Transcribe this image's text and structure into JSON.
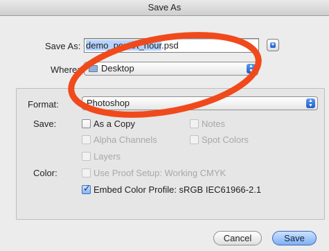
{
  "window": {
    "title": "Save As"
  },
  "save_as": {
    "label": "Save As:",
    "filename_selected": "demo_popart_hour",
    "filename_ext": ".psd"
  },
  "where": {
    "label": "Where:",
    "value": "Desktop"
  },
  "format": {
    "label": "Format:",
    "value": "Photoshop"
  },
  "save_options": {
    "label": "Save:",
    "as_a_copy": "As a Copy",
    "alpha_channels": "Alpha Channels",
    "layers": "Layers",
    "notes": "Notes",
    "spot_colors": "Spot Colors"
  },
  "color": {
    "label": "Color:",
    "use_proof_setup": "Use Proof Setup:  Working CMYK",
    "embed_profile": "Embed Color Profile:  sRGB IEC61966-2.1",
    "embed_checked": true
  },
  "buttons": {
    "cancel": "Cancel",
    "save": "Save"
  },
  "colors": {
    "annotation": "#f04a1c",
    "accent": "#2a64d6"
  }
}
